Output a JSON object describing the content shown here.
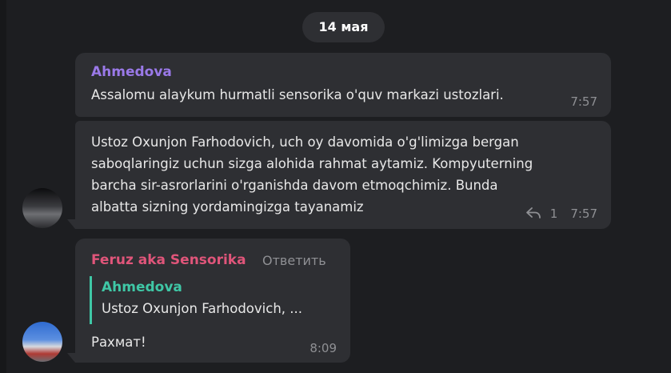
{
  "date_separator": "14 мая",
  "messages": [
    {
      "sender": "Ahmedova",
      "sender_color": "#9a79e8",
      "text": "Assalomu alaykum hurmatli sensorika o'quv markazi ustozlari.",
      "time": "7:57"
    },
    {
      "text_lines": [
        "Ustoz Oxunjon Farhodovich, uch oy davomida o'g'limizga bergan",
        "saboqlaringiz uchun sizga alohida rahmat aytamiz. Kompyuterning",
        "barcha sir-asrorlarini o'rganishda davom etmoqchimiz. Bunda",
        "albatta sizning yordamingizga tayanamiz"
      ],
      "reply_count": "1",
      "time": "7:57",
      "avatar_icon": "user-avatar-icon"
    },
    {
      "sender": "Feruz aka Sensorika",
      "sender_color": "#e0557a",
      "reply_action": "Ответить",
      "quote": {
        "name": "Ahmedova",
        "text": "Ustoz Oxunjon Farhodovich, ...",
        "color": "#3fc7a6"
      },
      "text": "Рахмат!",
      "time": "8:09",
      "avatar_icon": "user-avatar-icon"
    }
  ]
}
